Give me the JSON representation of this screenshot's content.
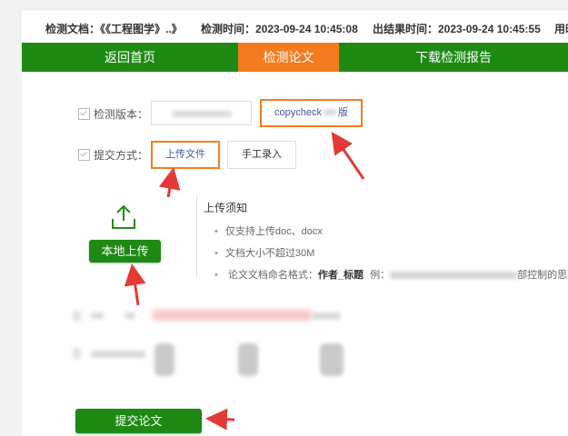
{
  "info_bar": {
    "doc": "检测文档：《《工程图学》..》",
    "check_time": "检测时间：2023-09-24 10:45:08",
    "result_time": "出结果时间：2023-09-24 10:45:55",
    "time_used": "用时"
  },
  "nav": {
    "home": "返回首页",
    "check": "检测论文",
    "download": "下载检测报告"
  },
  "form": {
    "version_label": "检测版本：",
    "version_selected": "copycheck",
    "version_suffix": "版",
    "submit_method_label": "提交方式：",
    "upload_file": "上传文件",
    "manual_entry": "手工录入"
  },
  "upload": {
    "local_upload_label": "本地上传",
    "notes_title": "上传须知",
    "notes": [
      "仅支持上传doc、docx",
      "文档大小不超过30M"
    ],
    "naming_prefix": "论文文档命名格式：",
    "naming_format": "作者_标题",
    "naming_example_label": "例：",
    "naming_example_tail": "部控制的思考"
  },
  "submit": {
    "label": "提交论文"
  },
  "colors": {
    "green": "#1e8a14",
    "orange": "#f47c20",
    "arrow_red": "#e53935"
  }
}
